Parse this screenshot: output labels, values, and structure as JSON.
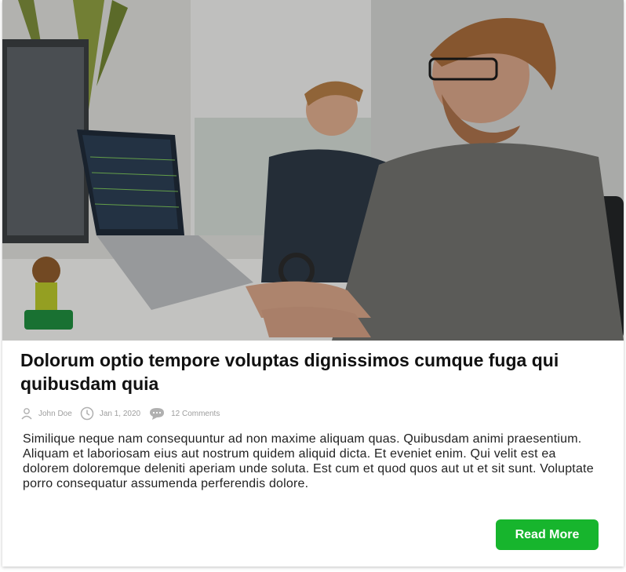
{
  "post": {
    "image_alt": "Two men working at computers in an office",
    "title": "Dolorum optio tempore voluptas dignissimos cumque fuga qui quibusdam quia",
    "author": "John Doe",
    "date": "Jan 1, 2020",
    "comments": "12 Comments",
    "excerpt": "Similique neque nam consequuntur ad non maxime aliquam quas. Quibusdam animi praesentium. Aliquam et laboriosam eius aut nostrum quidem aliquid dicta. Et eveniet enim. Qui velit est ea dolorem doloremque deleniti aperiam unde soluta. Est cum et quod quos aut ut et sit sunt. Voluptate porro consequatur assumenda perferendis dolore.",
    "read_more_label": "Read More"
  },
  "icons": {
    "author": "user-icon",
    "date": "clock-icon",
    "comments": "chat-bubble-icon"
  },
  "colors": {
    "button_bg": "#17b52d",
    "meta_text": "#9e9e9e",
    "title_text": "#111111"
  }
}
